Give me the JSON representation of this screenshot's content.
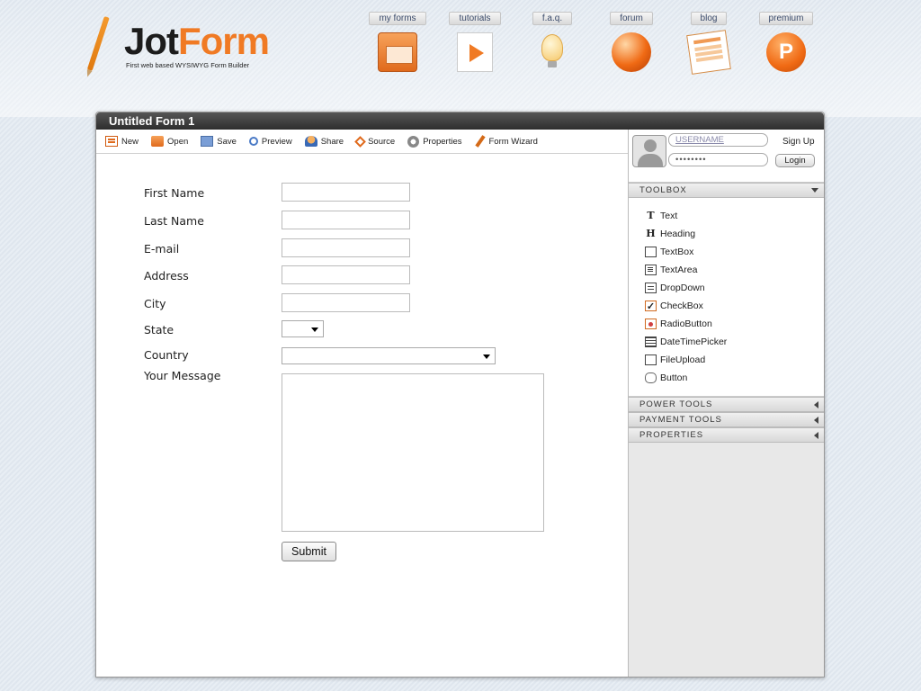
{
  "logo": {
    "part1": "Jot",
    "part2": "Form",
    "tagline": "First web based WYSIWYG Form Builder"
  },
  "nav": [
    {
      "label": "my forms",
      "icon": "folder-icon"
    },
    {
      "label": "tutorials",
      "icon": "video-icon"
    },
    {
      "label": "f.a.q.",
      "icon": "lightbulb-icon"
    },
    {
      "label": "forum",
      "icon": "globe-icon"
    },
    {
      "label": "blog",
      "icon": "blog-icon"
    },
    {
      "label": "premium",
      "icon": "premium-icon",
      "icon_text": "P"
    }
  ],
  "window": {
    "title": "Untitled Form 1"
  },
  "toolbar": {
    "new": "New",
    "open": "Open",
    "save": "Save",
    "preview": "Preview",
    "share": "Share",
    "source": "Source",
    "properties": "Properties",
    "wizard": "Form Wizard"
  },
  "form": {
    "fields": [
      {
        "label": "First Name",
        "type": "text"
      },
      {
        "label": "Last Name",
        "type": "text"
      },
      {
        "label": "E-mail",
        "type": "text"
      },
      {
        "label": "Address",
        "type": "text"
      },
      {
        "label": "City",
        "type": "text"
      },
      {
        "label": "State",
        "type": "select"
      },
      {
        "label": "Country",
        "type": "select"
      },
      {
        "label": "Your Message",
        "type": "textarea"
      }
    ],
    "submit": "Submit"
  },
  "login": {
    "username_placeholder": "USERNAME",
    "password_mask": "••••••••",
    "signup": "Sign Up",
    "login": "Login"
  },
  "panel": {
    "toolbox_title": "TOOLBOX",
    "tools": [
      {
        "label": "Text",
        "icon": "text-icon",
        "glyph": "T"
      },
      {
        "label": "Heading",
        "icon": "heading-icon",
        "glyph": "H"
      },
      {
        "label": "TextBox",
        "icon": "textbox-icon"
      },
      {
        "label": "TextArea",
        "icon": "textarea-icon"
      },
      {
        "label": "DropDown",
        "icon": "dropdown-icon"
      },
      {
        "label": "CheckBox",
        "icon": "checkbox-icon",
        "glyph": "✓"
      },
      {
        "label": "RadioButton",
        "icon": "radiobutton-icon"
      },
      {
        "label": "DateTimePicker",
        "icon": "datetime-icon"
      },
      {
        "label": "FileUpload",
        "icon": "fileupload-icon"
      },
      {
        "label": "Button",
        "icon": "button-icon"
      }
    ],
    "power_tools": "POWER TOOLS",
    "payment_tools": "PAYMENT TOOLS",
    "properties": "PROPERTIES"
  },
  "colors": {
    "accent": "#f07a24",
    "titlebar": "#333333"
  }
}
